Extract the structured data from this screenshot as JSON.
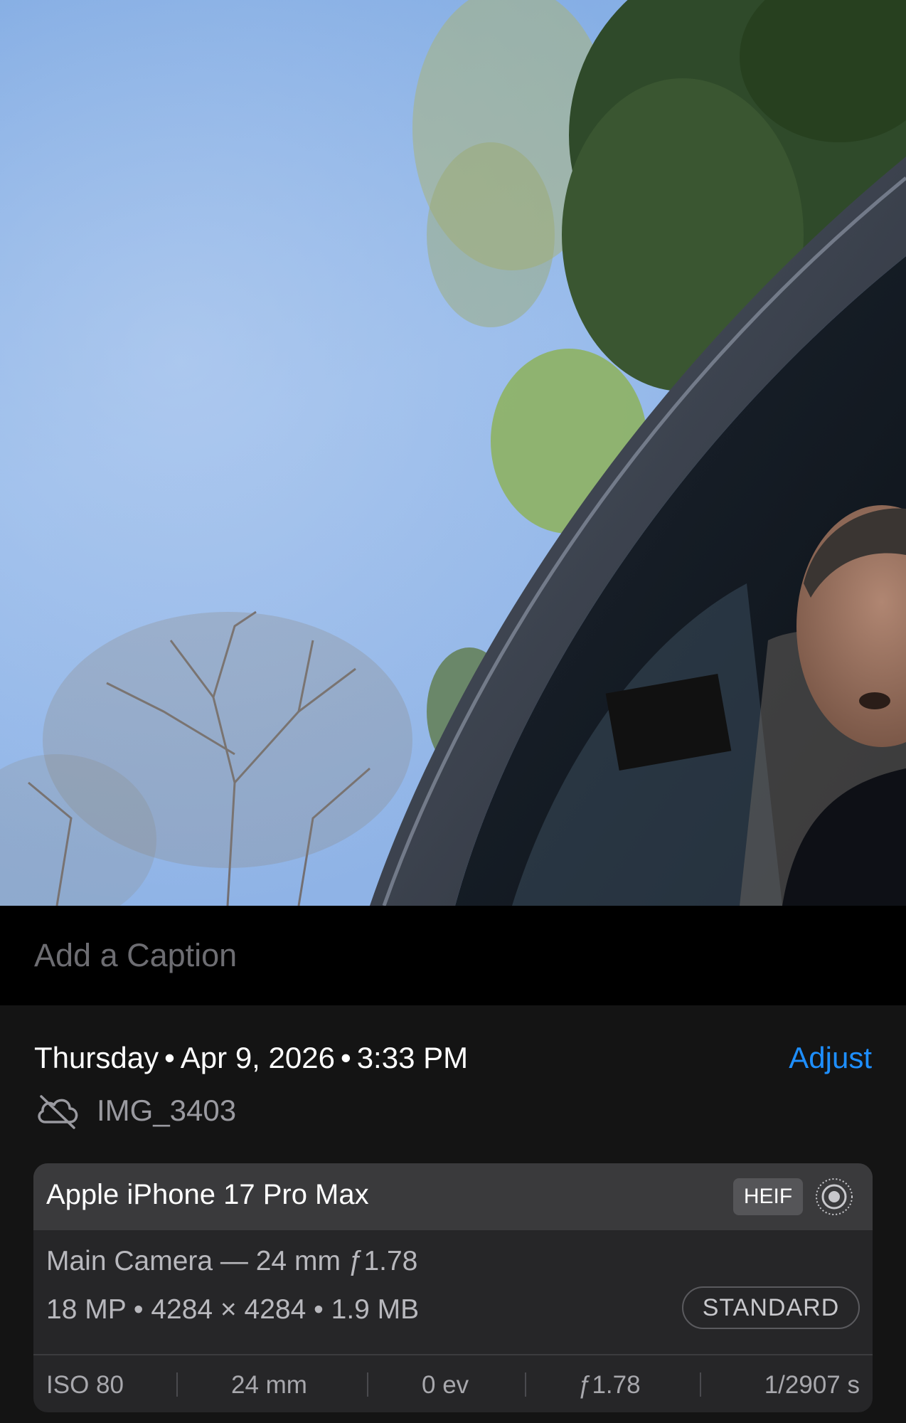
{
  "caption": {
    "placeholder": "Add a Caption"
  },
  "info": {
    "day": "Thursday",
    "date": "Apr 9, 2026",
    "time": "3:33 PM",
    "separator": "•",
    "adjust_label": "Adjust",
    "file_name": "IMG_3403",
    "cloud_icon": "cloud-slash-icon"
  },
  "camera": {
    "device": "Apple iPhone 17 Pro Max",
    "format": "HEIF",
    "live_icon": "live-photo-icon",
    "lens": "Main Camera — 24 mm ƒ1.78",
    "specs": "18 MP • 4284 × 4284 • 1.9 MB",
    "style": "STANDARD"
  },
  "exif": {
    "iso": "ISO 80",
    "focal": "24 mm",
    "ev": "0 ev",
    "aperture": "ƒ1.78",
    "shutter": "1/2907 s"
  },
  "colors": {
    "accent": "#1e8fff",
    "panel": "#141414",
    "card": "#262628",
    "card_header": "#3a3a3c"
  }
}
